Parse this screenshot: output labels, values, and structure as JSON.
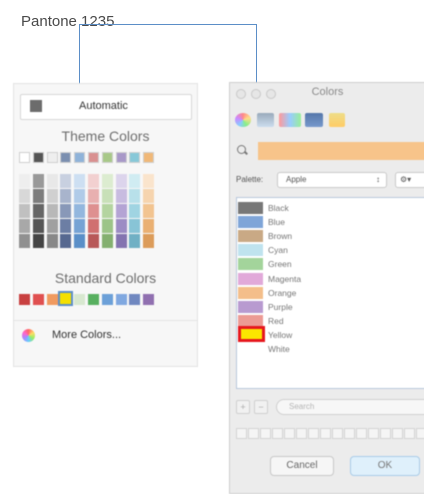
{
  "callout": {
    "label": "Pantone 1235",
    "line_color": "#5b8ec7"
  },
  "office_palette": {
    "automatic_label": "Automatic",
    "automatic_swatch": "#6c6c6c",
    "theme_colors_title": "Theme Colors",
    "theme_swatches": [
      "#ffffff",
      "#555555",
      "#eeeeee",
      "#7b8fb0",
      "#8fb3d9",
      "#d99090",
      "#a8c888",
      "#a898c8",
      "#88c8d8",
      "#f0b878"
    ],
    "shade_columns": [
      [
        "#eeeeee",
        "#d8d8d8",
        "#c0c0c0",
        "#a8a8a8",
        "#909090"
      ],
      [
        "#999999",
        "#7d7d7d",
        "#666666",
        "#555555",
        "#444444"
      ],
      [
        "#e8e8e8",
        "#d0d0d0",
        "#b8b8b8",
        "#a0a0a0",
        "#888888"
      ],
      [
        "#c8d0e0",
        "#a8b4cc",
        "#8898b8",
        "#6c7ea4",
        "#566890"
      ],
      [
        "#cddff2",
        "#b0cbe8",
        "#93b7de",
        "#76a3d4",
        "#5a8fc8"
      ],
      [
        "#f2d0d0",
        "#e8b0b0",
        "#de9090",
        "#d07070",
        "#b85858"
      ],
      [
        "#dcecd0",
        "#c8e0b8",
        "#b4d4a0",
        "#9cc488",
        "#84b070"
      ],
      [
        "#dcd4ec",
        "#c8bce0",
        "#b4a4d4",
        "#9c8cc4",
        "#8474b0"
      ],
      [
        "#d0ecf2",
        "#b8e0ea",
        "#a0d4e2",
        "#88c4d6",
        "#70b0c4"
      ],
      [
        "#fae4cc",
        "#f6d4ae",
        "#f2c490",
        "#eab072",
        "#dc9c5a"
      ]
    ],
    "standard_colors_title": "Standard Colors",
    "standard_swatches": [
      "#c84040",
      "#e05050",
      "#f09a60",
      "#f5e000",
      "#d8e8d0",
      "#58b060",
      "#6ca0d8",
      "#80a8e0",
      "#7088c0",
      "#9070b0"
    ],
    "selected_standard_index": 3,
    "more_colors_label": "More Colors..."
  },
  "mac_colors": {
    "window_title": "Colors",
    "search_color": "#f7c48a",
    "palette_label": "Palette:",
    "palette_value": "Apple",
    "palette_arrows": "↕",
    "gear_label": "⚙▾",
    "items": [
      {
        "name": "Black",
        "color": "#777777"
      },
      {
        "name": "Blue",
        "color": "#7fa5d8"
      },
      {
        "name": "Brown",
        "color": "#c9a985"
      },
      {
        "name": "Cyan",
        "color": "#bfe3ee"
      },
      {
        "name": "Green",
        "color": "#a3d49b"
      },
      {
        "name": "Magenta",
        "color": "#e1a9d9"
      },
      {
        "name": "Orange",
        "color": "#f4be8a"
      },
      {
        "name": "Purple",
        "color": "#b89ad0"
      },
      {
        "name": "Red",
        "color": "#ec9a94"
      },
      {
        "name": "Yellow",
        "color": "#fbe700"
      },
      {
        "name": "White",
        "color": "#ffffff"
      }
    ],
    "selected_item_index": 9,
    "plus_label": "+",
    "minus_label": "−",
    "search_placeholder": "Search",
    "cancel_label": "Cancel",
    "ok_label": "OK"
  }
}
